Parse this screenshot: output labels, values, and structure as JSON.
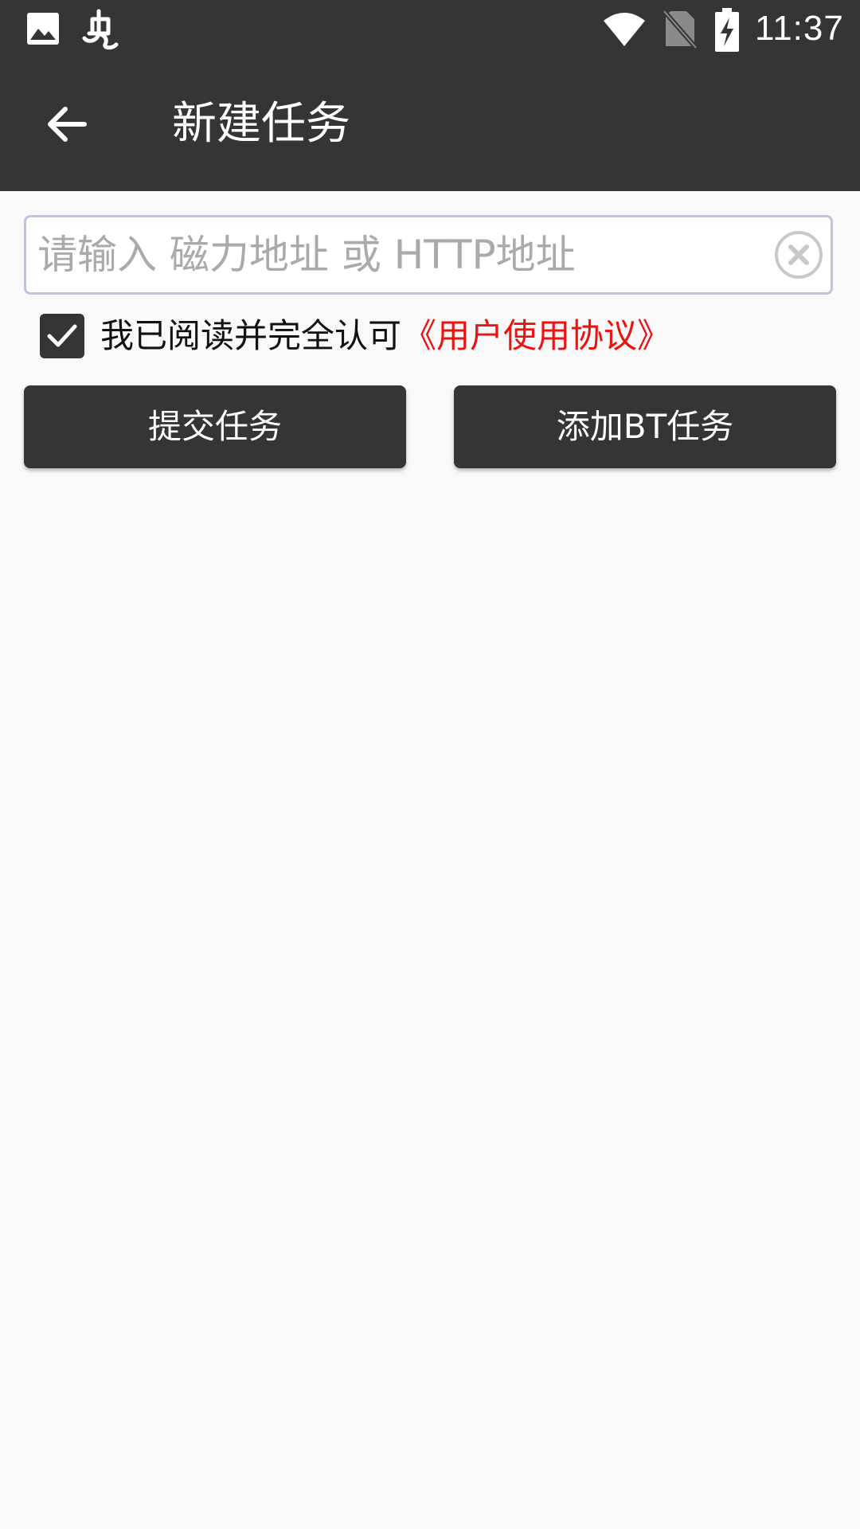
{
  "status_bar": {
    "time": "11:37",
    "icons": [
      "gallery-icon",
      "app-notification-icon",
      "wifi-icon",
      "no-sim-icon",
      "battery-charging-icon"
    ]
  },
  "app_bar": {
    "back_icon": "arrow-left-icon",
    "title": "新建任务"
  },
  "url_input": {
    "value": "",
    "placeholder": "请输入 磁力地址 或 HTTP地址",
    "clear_icon": "clear-circle-icon"
  },
  "agreement": {
    "checked": true,
    "text": "我已阅读并完全认可",
    "link_text": "《用户使用协议》",
    "link_color": "#ee1111"
  },
  "actions": {
    "submit_label": "提交任务",
    "add_bt_label": "添加BT任务"
  },
  "colors": {
    "bar_background": "#353535",
    "page_background": "#f9f9f9",
    "input_border": "#bcc6da"
  }
}
